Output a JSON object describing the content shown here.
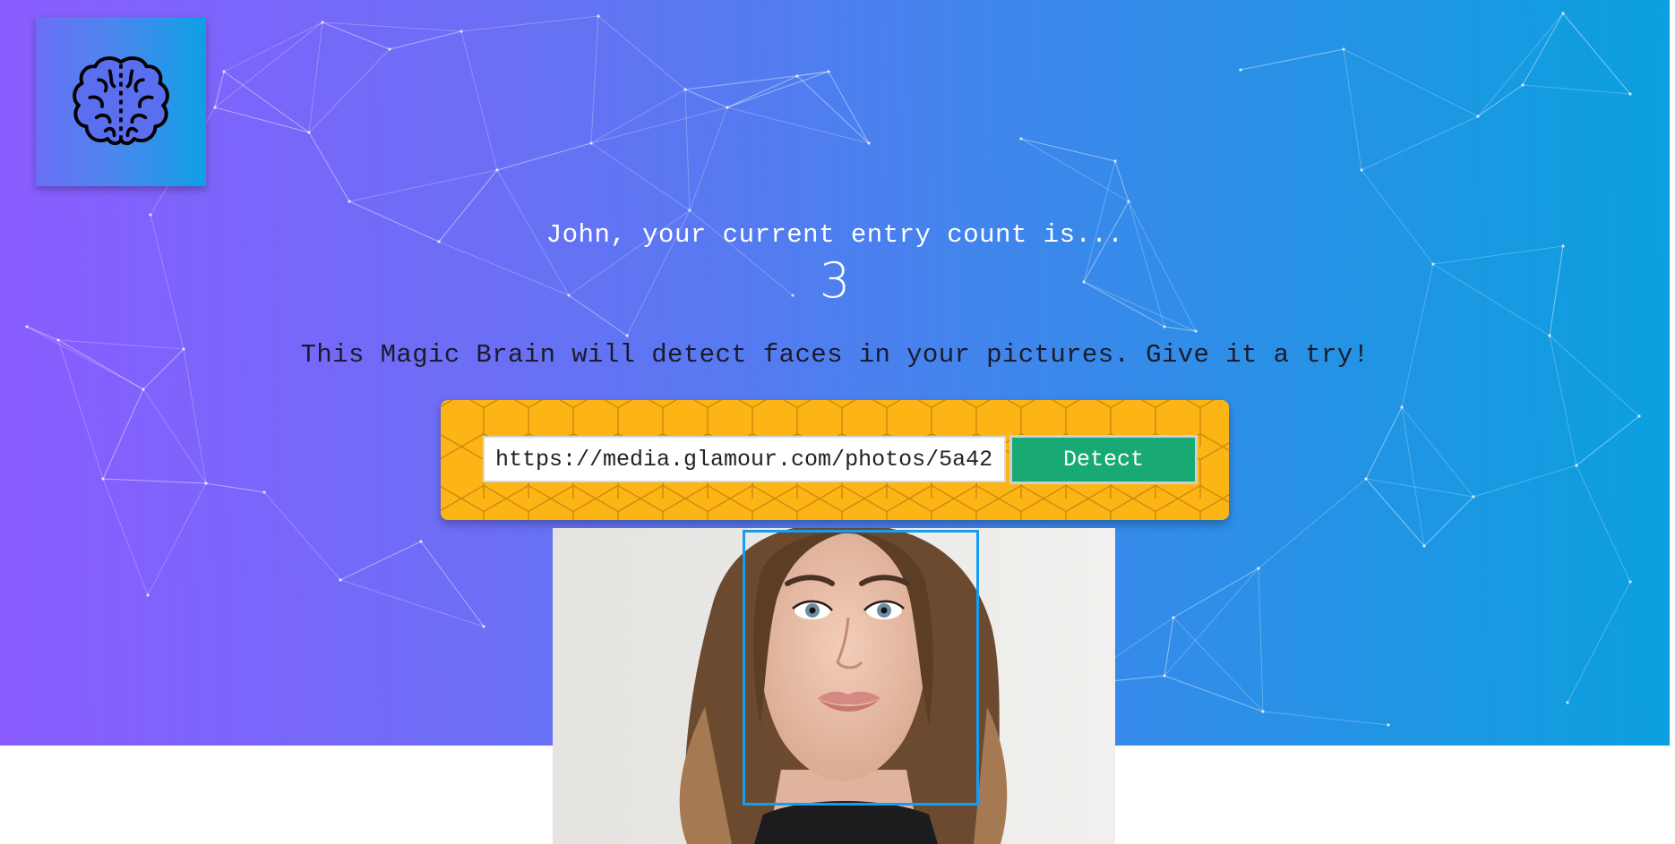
{
  "header": {
    "logo_icon": "brain-icon"
  },
  "rank": {
    "entry_text": "John, your current entry count is...",
    "entry_count": "3"
  },
  "tagline": "This Magic Brain will detect faces in your pictures. Give it a try!",
  "form": {
    "url_value": "https://media.glamour.com/photos/5a42",
    "detect_label": "Detect"
  },
  "colors": {
    "gradient_start": "#8a5cff",
    "gradient_end": "#0aa0de",
    "panel": "#fdb515",
    "button": "#19a974",
    "face_box": "#149df2"
  }
}
